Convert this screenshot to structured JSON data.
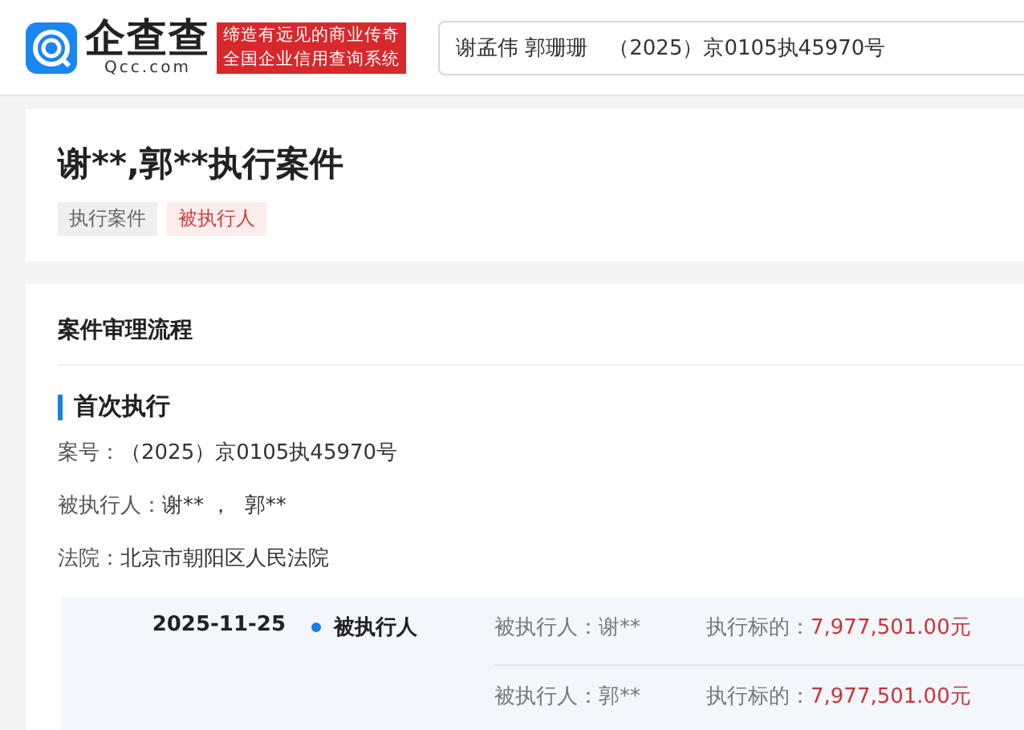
{
  "header": {
    "brand": "企查查",
    "domain": "Qcc.com",
    "slogan": [
      "缔造有远见的商业传奇",
      "全国企业信用查询系统"
    ],
    "search": {
      "value": "谢孟伟 郭珊珊　（2025）京0105执45970号"
    }
  },
  "case": {
    "title": "谢**,郭**执行案件",
    "tags": [
      {
        "label": "执行案件",
        "kind": "neutral"
      },
      {
        "label": "被执行人",
        "kind": "alert"
      }
    ]
  },
  "process": {
    "heading": "案件审理流程",
    "stage": "首次执行",
    "fields": [
      {
        "label": "案号：",
        "value": "（2025）京0105执45970号"
      },
      {
        "label": "被执行人：",
        "value": "谢** ，  郭**"
      },
      {
        "label": "法院：",
        "value": "北京市朝阳区人民法院"
      }
    ],
    "records": [
      {
        "date": "2025-11-25",
        "type": "被执行人",
        "entries": [
          {
            "party_label": "被执行人：",
            "party": "谢**",
            "amount_label": "执行标的：",
            "amount": "7,977,501.00元"
          },
          {
            "party_label": "被执行人：",
            "party": "郭**",
            "amount_label": "执行标的：",
            "amount": "7,977,501.00元"
          }
        ]
      }
    ]
  }
}
